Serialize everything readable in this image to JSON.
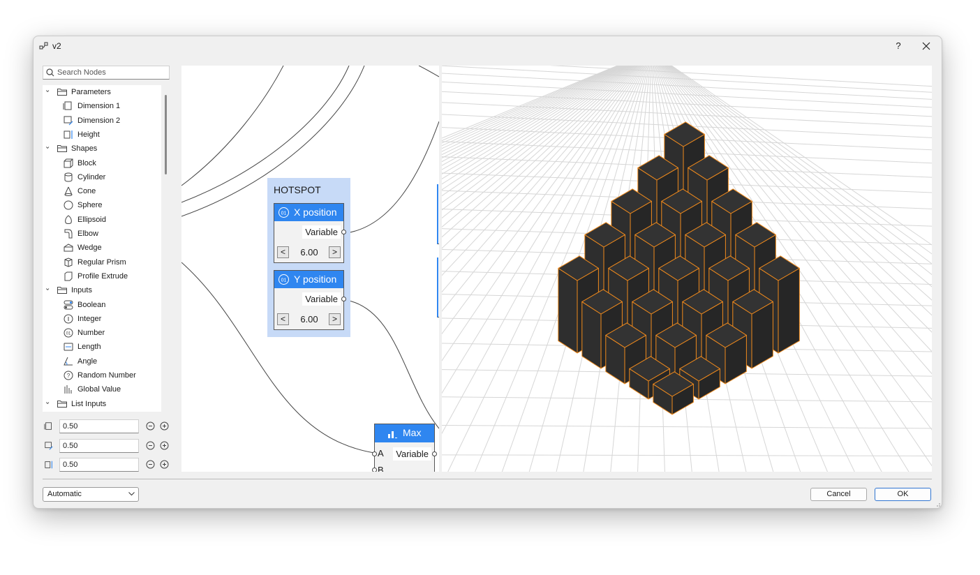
{
  "window": {
    "title": "v2",
    "help_label": "?"
  },
  "search": {
    "placeholder": "Search Nodes"
  },
  "tree": {
    "groups": [
      {
        "label": "Parameters",
        "items": [
          "Dimension 1",
          "Dimension 2",
          "Height"
        ]
      },
      {
        "label": "Shapes",
        "items": [
          "Block",
          "Cylinder",
          "Cone",
          "Sphere",
          "Ellipsoid",
          "Elbow",
          "Wedge",
          "Regular Prism",
          "Profile Extrude"
        ]
      },
      {
        "label": "Inputs",
        "items": [
          "Boolean",
          "Integer",
          "Number",
          "Length",
          "Angle",
          "Random Number",
          "Global Value"
        ]
      },
      {
        "label": "List Inputs",
        "items": []
      }
    ]
  },
  "parameters": [
    {
      "value": "0.50",
      "icon": "dimension-1-icon"
    },
    {
      "value": "0.50",
      "icon": "dimension-2-icon"
    },
    {
      "value": "0.50",
      "icon": "height-icon"
    }
  ],
  "graph": {
    "group_label": "HOTSPOT",
    "x_node": {
      "title": "X position",
      "output": "Variable",
      "value": "6.00",
      "dec": "<",
      "inc": ">"
    },
    "y_node": {
      "title": "Y position",
      "output": "Variable",
      "value": "6.00",
      "dec": "<",
      "inc": ">"
    },
    "max_node": {
      "title": "Max",
      "input_a": "A",
      "input_b": "B",
      "output": "Variable"
    }
  },
  "viewport": {
    "edge_color": "#f08a1c",
    "box_color": "#2b2b2b",
    "heights": [
      [
        1,
        1,
        2,
        3,
        4
      ],
      [
        1,
        2,
        3,
        4,
        5
      ],
      [
        2,
        3,
        4,
        5,
        6
      ],
      [
        3,
        4,
        5,
        6,
        7
      ],
      [
        4,
        5,
        6,
        7,
        8
      ]
    ]
  },
  "footer": {
    "mode": "Automatic",
    "cancel": "Cancel",
    "ok": "OK"
  }
}
